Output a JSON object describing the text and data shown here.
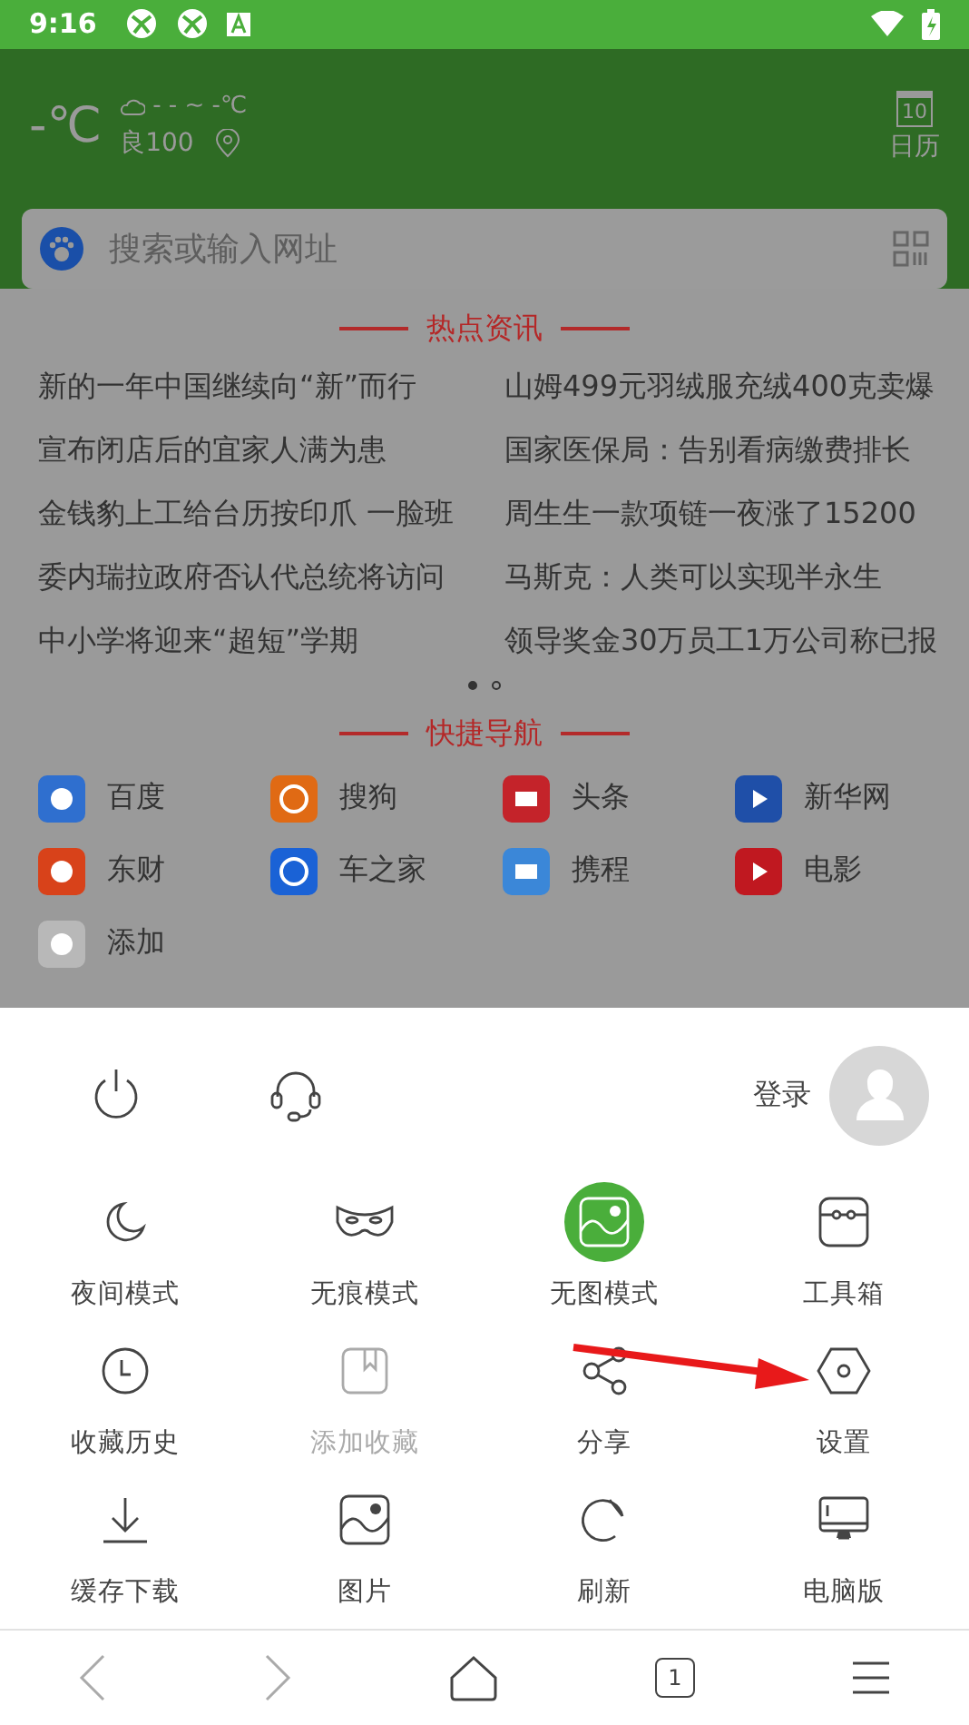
{
  "status_bar": {
    "time": "9:16"
  },
  "weather": {
    "temperature": "-℃",
    "range": "- - ~ -℃",
    "air_quality": "良100",
    "calendar_day": "10",
    "calendar_label": "日历"
  },
  "search": {
    "placeholder": "搜索或输入网址"
  },
  "news": {
    "title": "热点资讯",
    "items": [
      "新的一年中国继续向“新”而行",
      "山姆499元羽绒服充绒400克卖爆",
      "宣布闭店后的宜家人满为患",
      "国家医保局：告别看病缴费排长",
      "金钱豹上工给台历按印爪 一脸班",
      "周生生一款项链一夜涨了15200",
      "委内瑞拉政府否认代总统将访问",
      "马斯克：人类可以实现半永生",
      "中小学将迎来“超短”学期",
      "领导奖金30万员工1万公司称已报"
    ],
    "pages": [
      {
        "selected": true
      },
      {
        "selected": false
      }
    ]
  },
  "quick_nav": {
    "title": "快捷导航",
    "items": [
      {
        "label": "百度",
        "color": "#2f6fcf"
      },
      {
        "label": "搜狗",
        "color": "#e06a14"
      },
      {
        "label": "头条",
        "color": "#c4232a"
      },
      {
        "label": "新华网",
        "color": "#1f4fa8"
      },
      {
        "label": "东财",
        "color": "#d8421a"
      },
      {
        "label": "车之家",
        "color": "#1a62d6"
      },
      {
        "label": "携程",
        "color": "#3b87d8"
      },
      {
        "label": "电影",
        "color": "#c01820"
      },
      {
        "label": "添加",
        "color": "#b8b8b8"
      }
    ]
  },
  "menu": {
    "login": "登录",
    "items": [
      {
        "label": "夜间模式",
        "kind": "moon",
        "active": false,
        "disabled": false
      },
      {
        "label": "无痕模式",
        "kind": "mask",
        "active": false,
        "disabled": false
      },
      {
        "label": "无图模式",
        "kind": "image",
        "active": true,
        "disabled": false
      },
      {
        "label": "工具箱",
        "kind": "toolbox",
        "active": false,
        "disabled": false
      },
      {
        "label": "收藏历史",
        "kind": "clock",
        "active": false,
        "disabled": false
      },
      {
        "label": "添加收藏",
        "kind": "bookmark",
        "active": false,
        "disabled": true
      },
      {
        "label": "分享",
        "kind": "share",
        "active": false,
        "disabled": false
      },
      {
        "label": "设置",
        "kind": "hexagon",
        "active": false,
        "disabled": false
      },
      {
        "label": "缓存下载",
        "kind": "download",
        "active": false,
        "disabled": false
      },
      {
        "label": "图片",
        "kind": "image",
        "active": false,
        "disabled": false
      },
      {
        "label": "刷新",
        "kind": "refresh",
        "active": false,
        "disabled": false
      },
      {
        "label": "电脑版",
        "kind": "monitor",
        "active": false,
        "disabled": false
      }
    ]
  },
  "bottom_nav": {
    "tab_count": "1"
  }
}
